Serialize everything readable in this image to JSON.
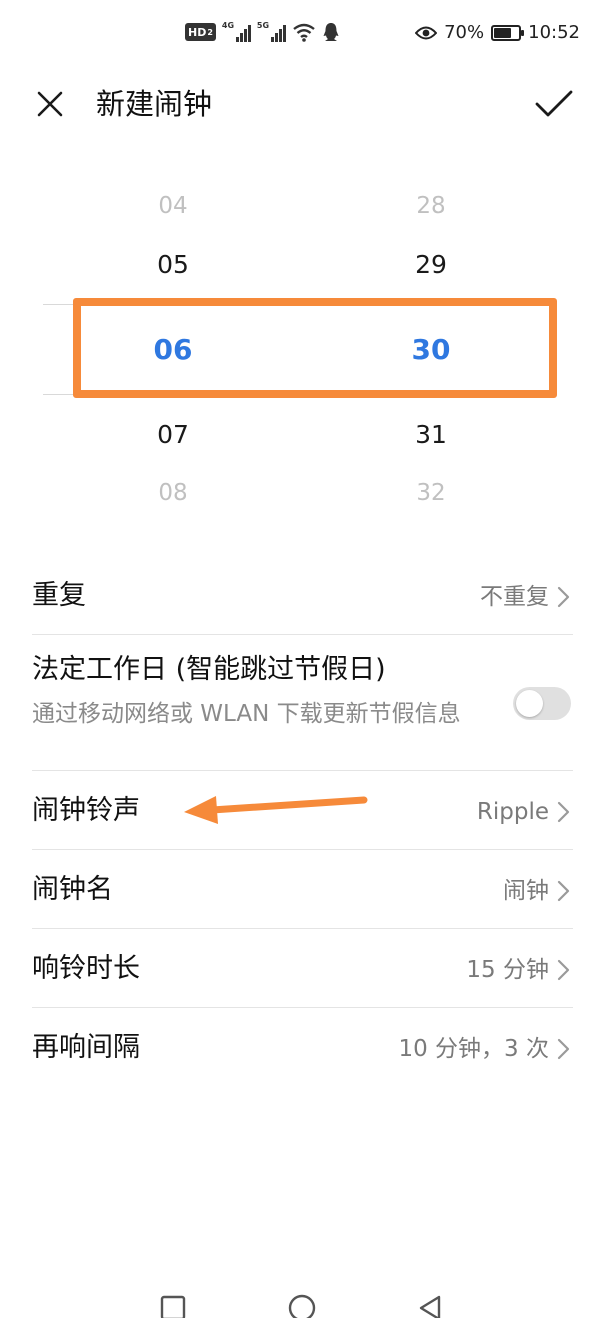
{
  "status_bar": {
    "hd_label": "HD",
    "hd_sub": "2",
    "sim1_network": "4G",
    "sim2_network": "5G",
    "battery_percent_text": "70%",
    "battery_level": 0.7,
    "time": "10:52",
    "icons": [
      "hd-icon",
      "signal-icon",
      "signal-icon",
      "wifi-icon",
      "qq-icon",
      "eye-icon",
      "battery-icon"
    ]
  },
  "header": {
    "title": "新建闹钟",
    "close_icon": "close-icon",
    "confirm_icon": "check-icon"
  },
  "picker": {
    "hours": [
      "04",
      "05",
      "06",
      "07",
      "08"
    ],
    "minutes": [
      "28",
      "29",
      "30",
      "31",
      "32"
    ],
    "selected_hour": "06",
    "selected_minute": "30"
  },
  "settings": {
    "repeat": {
      "label": "重复",
      "value": "不重复"
    },
    "workday": {
      "label": "法定工作日 (智能跳过节假日)",
      "sublabel": "通过移动网络或 WLAN 下载更新节假信息",
      "enabled": false
    },
    "ringtone": {
      "label": "闹钟铃声",
      "value": "Ripple"
    },
    "name": {
      "label": "闹钟名",
      "value": "闹钟"
    },
    "duration": {
      "label": "响铃时长",
      "value": "15 分钟"
    },
    "snooze": {
      "label": "再响间隔",
      "value": "10 分钟，3 次"
    }
  },
  "annotation_color": "#f68a3a",
  "accent_color": "#2f78e0",
  "nav_bar": {
    "icons": [
      "recents-square-icon",
      "home-circle-icon",
      "back-triangle-icon"
    ]
  }
}
